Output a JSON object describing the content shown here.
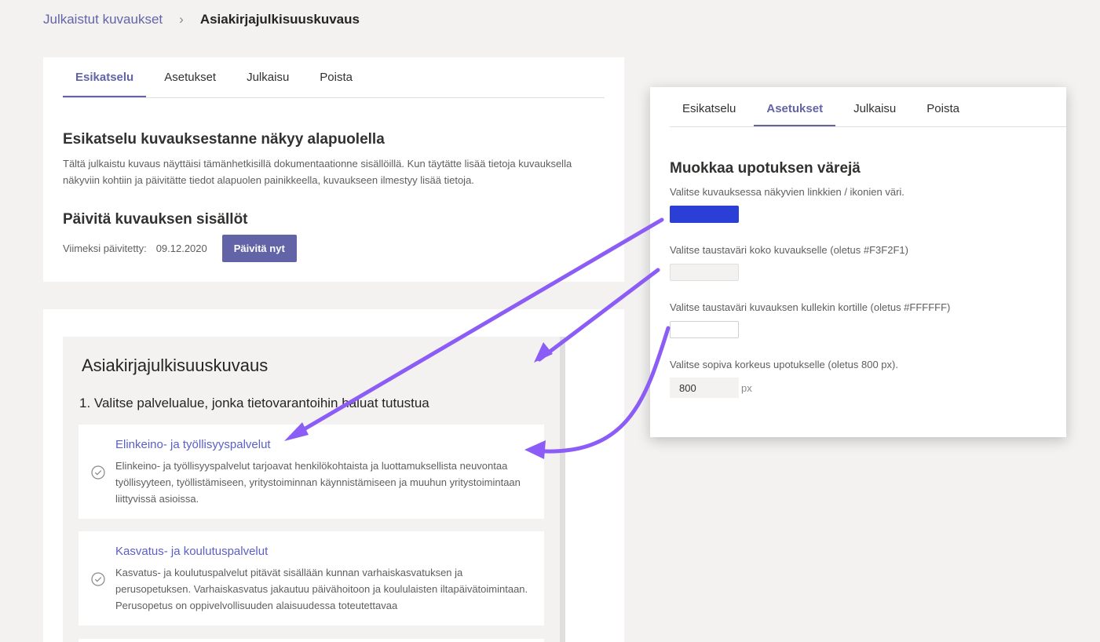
{
  "breadcrumb": {
    "parent": "Julkaistut kuvaukset",
    "separator": "›",
    "current": "Asiakirjajulkisuuskuvaus"
  },
  "main_card": {
    "tabs": [
      "Esikatselu",
      "Asetukset",
      "Julkaisu",
      "Poista"
    ],
    "active_tab": "Esikatselu",
    "preview_heading": "Esikatselu kuvauksestanne näkyy alapuolella",
    "preview_description": "Tältä julkaistu kuvaus näyttäisi tämänhetkisillä dokumentaationne sisällöillä. Kun täytätte lisää tietoja kuvauksella näkyviin kohtiin ja päivitätte tiedot alapuolen painikkeella, kuvaukseen ilmestyy lisää tietoja.",
    "update_heading": "Päivitä kuvauksen sisällöt",
    "last_updated_label": "Viimeksi päivitetty:",
    "last_updated_date": "09.12.2020",
    "update_button": "Päivitä nyt"
  },
  "preview": {
    "title": "Asiakirjajulkisuuskuvaus",
    "question": "1. Valitse palvelualue, jonka tietovarantoihin haluat tutustua",
    "services": [
      {
        "title": "Elinkeino- ja työllisyyspalvelut",
        "description": "Elinkeino- ja työllisyyspalvelut tarjoavat henkilökohtaista ja luottamuksellista neuvontaa työllisyyteen, työllistämiseen, yritystoiminnan käynnistämiseen ja muuhun yritystoimintaan liittyvissä asioissa."
      },
      {
        "title": "Kasvatus- ja koulutuspalvelut",
        "description": "Kasvatus- ja koulutuspalvelut pitävät sisällään kunnan varhaiskasvatuksen ja perusopetuksen. Varhaiskasvatus jakautuu päivähoitoon ja koululaisten iltapäivätoimintaan. Perusopetus on oppivelvollisuuden alaisuudessa toteutettavaa"
      }
    ]
  },
  "settings_card": {
    "tabs": [
      "Esikatselu",
      "Asetukset",
      "Julkaisu",
      "Poista"
    ],
    "active_tab": "Asetukset",
    "heading": "Muokkaa upotuksen värejä",
    "link_color_label": "Valitse kuvauksessa näkyvien linkkien / ikonien väri.",
    "link_color": "#2b3fd6",
    "bg_color_label": "Valitse taustaväri koko kuvaukselle (oletus #F3F2F1)",
    "bg_color": "#F3F2F1",
    "card_color_label": "Valitse taustaväri kuvauksen kullekin kortille (oletus #FFFFFF)",
    "card_color": "#FFFFFF",
    "height_label": "Valitse sopiva korkeus upotukselle (oletus 800 px).",
    "height_value": "800",
    "height_unit": "px"
  },
  "colors": {
    "accent": "#6264a7",
    "annotation_arrow": "#8b5cf6"
  }
}
